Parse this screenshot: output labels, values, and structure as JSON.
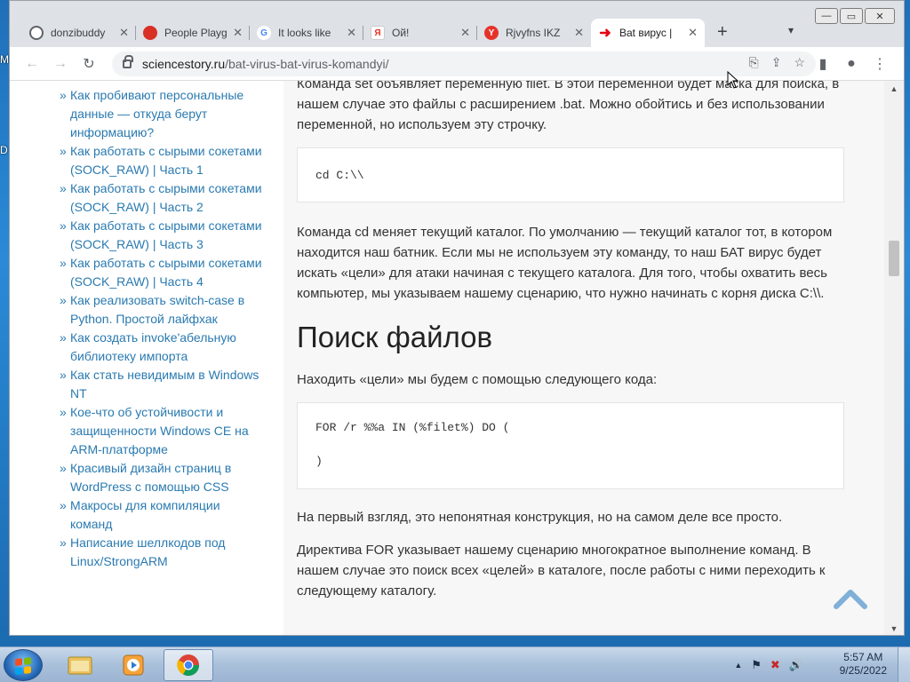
{
  "desktop": {
    "edge_text_top": "M",
    "edge_text_mid": "D"
  },
  "tabs": [
    {
      "title": "donzibuddy",
      "color": "#5f6368",
      "glyph": ""
    },
    {
      "title": "People Playg",
      "color": "#d93025",
      "glyph": ""
    },
    {
      "title": "It looks like",
      "color": "#4285f4",
      "glyph": "G"
    },
    {
      "title": "Ой!",
      "color": "#e63329",
      "glyph": "Я"
    },
    {
      "title": "Rjvyfns IKZ",
      "color": "#e63329",
      "glyph": "Y"
    },
    {
      "title": "Bat вирус |",
      "color": "#e60012",
      "glyph": "➜"
    }
  ],
  "window_controls": {
    "minimize": "—",
    "maximize": "▭",
    "close": "✕"
  },
  "toolbar": {
    "back": "←",
    "forward": "→",
    "reload": "↻",
    "url_host": "sciencestory.ru",
    "url_path": "/bat-virus-bat-virus-komandyi/"
  },
  "sidebar": {
    "items": [
      "Как пробивают персональные данные — откуда берут информацию?",
      "Как работать с сырыми сокетами (SOCK_RAW) | Часть 1",
      "Как работать с сырыми сокетами (SOCK_RAW) | Часть 2",
      "Как работать с сырыми сокетами (SOCK_RAW) | Часть 3",
      "Как работать с сырыми сокетами (SOCK_RAW) | Часть 4",
      "Как реализовать switch-case в Python. Простой лайфхак",
      "Как создать invoke'абельную библиотеку импорта",
      "Как стать невидимым в Windows NT",
      "Кое-что об устойчивости и защищенности Windows CE на ARM-платформе",
      "Красивый дизайн страниц в WordPress с помощью CSS",
      "Макросы для компиляции команд",
      "Написание шеллкодов под Linux/StrongARM"
    ]
  },
  "article": {
    "p_set": "Команда set объявляет переменную filet. В этой переменной будет маска для поиска, в нашем случае это файлы с расширением .bat. Можно обойтись и без использовании переменной, но используем эту строчку.",
    "code_cd": "cd C:\\\\",
    "p_cd": "Команда cd меняет текущий каталог. По умолчанию — текущий каталог тот, в котором находится наш батник. Если мы не используем эту команду, то наш БАТ вирус будет искать «цели» для атаки начиная с текущего каталога. Для того, чтобы охватить весь компьютер, мы указываем нашему сценарию, что нужно начинать с корня диска C:\\\\.",
    "h_search": "Поиск файлов",
    "p_find": "Находить «цели» мы будем с помощью следующего кода:",
    "code_for_1": "FOR /r %%a IN (%filet%) DO (",
    "code_for_2": ")",
    "p_first": "На первый взгляд, это непонятная конструкция, но на самом деле все просто.",
    "p_directive": "Директива FOR указывает нашему сценарию многократное выполнение команд. В нашем случае это поиск всех «целей» в каталоге, после работы с ними переходить к следующему каталогу."
  },
  "taskbar": {
    "time": "5:57 AM",
    "date": "9/25/2022",
    "tray_expand": "▲"
  },
  "colors": {
    "link": "#2a7ab0",
    "accent_red": "#e60012"
  }
}
